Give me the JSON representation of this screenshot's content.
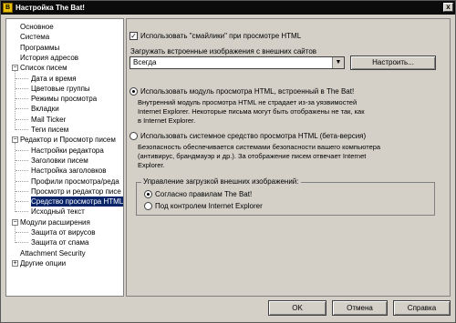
{
  "window": {
    "title": "Настройка The Bat!",
    "icon": "bat-app-icon",
    "close_label": "x"
  },
  "tree": {
    "items": [
      {
        "label": "Основное"
      },
      {
        "label": "Система"
      },
      {
        "label": "Программы"
      },
      {
        "label": "История адресов"
      },
      {
        "label": "Список писем"
      },
      {
        "label": "Дата и время"
      },
      {
        "label": "Цветовые группы"
      },
      {
        "label": "Режимы просмотра"
      },
      {
        "label": "Вкладки"
      },
      {
        "label": "Mail Ticker"
      },
      {
        "label": "Теги писем"
      },
      {
        "label": "Редактор и Просмотр писем"
      },
      {
        "label": "Настройки редактора"
      },
      {
        "label": "Заголовки писем"
      },
      {
        "label": "Настройка заголовков"
      },
      {
        "label": "Профили просмотра/реда"
      },
      {
        "label": "Просмотр и редактор писе"
      },
      {
        "label": "Средство просмотра HTML"
      },
      {
        "label": "Исходный текст"
      },
      {
        "label": "Модули расширения"
      },
      {
        "label": "Защита от вирусов"
      },
      {
        "label": "Защита от спама"
      },
      {
        "label": "Attachment Security"
      },
      {
        "label": "Другие опции"
      }
    ],
    "expanders": {
      "minus": "−",
      "plus": "+"
    }
  },
  "panel": {
    "use_smileys": {
      "label": "Использовать \"смайлики\" при просмотре HTML",
      "checked": true,
      "mark": "✓"
    },
    "load_images_label": "Загружать встроенные изображения с внешних сайтов",
    "load_images_select": {
      "value": "Всегда",
      "arrow": "▼"
    },
    "configure_button": "Настроить...",
    "radio_builtin": {
      "label": "Использовать модуль просмотра HTML, встроенный в The Bat!",
      "selected": true,
      "desc_lines": [
        "Внутренний модуль просмотра HTML не страдает из-за уязвимостей",
        "Internet Explorer. Некоторые письма могут быть отображены не так, как",
        "в Internet Explorer."
      ]
    },
    "radio_system": {
      "label": "Использовать системное средство просмотра HTML (бета-версия)",
      "selected": false,
      "desc_lines": [
        "Безопасность обеспечивается системами безопасности вашего компьютера",
        "(антивирус, брандмауэр и др.). За отображение писем отвечает Internet",
        "Explorer."
      ]
    },
    "group": {
      "title": "Управление загрузкой внешних изображений:",
      "radio_rules": {
        "label": "Согласно правилам The Bat!",
        "selected": true
      },
      "radio_ie": {
        "label": "Под контролем Internet Explorer",
        "selected": false
      }
    }
  },
  "footer": {
    "ok": "OK",
    "cancel": "Отмена",
    "help": "Справка"
  }
}
